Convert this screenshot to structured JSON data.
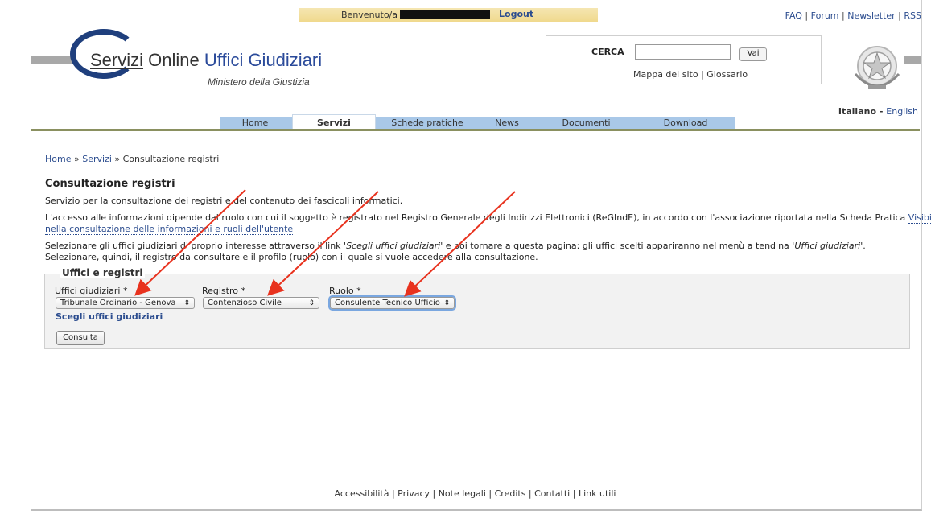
{
  "topbar": {
    "welcome_label": "Benvenuto/a S",
    "logout": "Logout",
    "links": [
      "FAQ",
      "Forum",
      "Newsletter",
      "RSS"
    ]
  },
  "header": {
    "title_part1": "Servizi",
    "title_part2": " Online ",
    "title_part3": "Uffici Giudiziari",
    "subtitle": "Ministero della Giustizia",
    "search_label": "CERCA",
    "search_value": "",
    "search_button": "Vai",
    "sitemap_link": "Mappa del sito",
    "glossary_link": "Glossario",
    "lang_current": "Italiano",
    "lang_other": "English"
  },
  "nav": {
    "tabs": [
      "Home",
      "Servizi",
      "Schede pratiche",
      "News",
      "Documenti",
      "Download"
    ],
    "active": "Servizi"
  },
  "breadcrumb": {
    "home": "Home",
    "servizi": "Servizi",
    "current": "Consultazione registri"
  },
  "main": {
    "title": "Consultazione registri",
    "intro": "Servizio per la consultazione dei registri e del contenuto dei fascicoli informatici.",
    "access_text_1": "L'accesso alle informazioni dipende dal ruolo con cui il soggetto è registrato nel Registro Generale degli Indirizzi Elettronici (ReGIndE), in accordo con l'associazione riportata nella Scheda Pratica ",
    "access_link_1": "Visibilità",
    "access_link_2": "nella consultazione delle informazioni e ruoli dell'utente",
    "select_text_a": "Selezionare gli uffici giudiziari di proprio interesse attraverso il link '",
    "select_link_text": "Scegli uffici giudiziari",
    "select_text_b": "' e poi tornare a questa pagina: gli uffici scelti appariranno nel menù a tendina '",
    "select_menu_text": "Uffici giudiziari",
    "select_text_c": "'.",
    "select_text_2": "Selezionare, quindi, il registro da consultare e il profilo (ruolo) con il quale si vuole accedere alla consultazione."
  },
  "form": {
    "legend": "Uffici e registri",
    "uffici_label": "Uffici giudiziari *",
    "uffici_value": "Tribunale Ordinario - Genova",
    "registro_label": "Registro *",
    "registro_value": "Contenzioso Civile",
    "ruolo_label": "Ruolo *",
    "ruolo_value": "Consulente Tecnico Ufficio",
    "choose_link": "Scegli uffici giudiziari",
    "submit": "Consulta"
  },
  "footer": {
    "links": [
      "Accessibilità",
      "Privacy",
      "Note legali",
      "Credits",
      "Contatti",
      "Link utili"
    ]
  },
  "colors": {
    "link": "#2c4d8f",
    "tab": "#a9c8e8",
    "annotation_arrow": "#e8321e"
  }
}
